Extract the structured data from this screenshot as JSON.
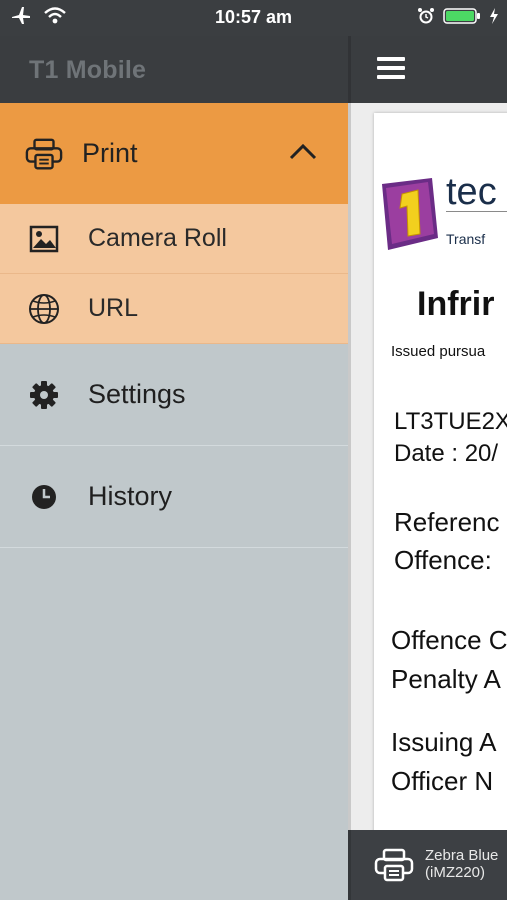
{
  "status_bar": {
    "time": "10:57 am",
    "left_icons": [
      "airplane-icon",
      "wifi-icon"
    ],
    "right_icons": [
      "alarm-icon",
      "battery-icon",
      "charging-icon"
    ]
  },
  "app": {
    "title": "T1 Mobile"
  },
  "drawer": {
    "print": {
      "label": "Print",
      "icon": "printer-icon",
      "expanded": true
    },
    "print_subitems": [
      {
        "label": "Camera Roll",
        "icon": "image-icon"
      },
      {
        "label": "URL",
        "icon": "globe-icon"
      }
    ],
    "items": [
      {
        "label": "Settings",
        "icon": "gear-icon"
      },
      {
        "label": "History",
        "icon": "clock-icon"
      }
    ]
  },
  "document": {
    "logo_text": "tec",
    "tagline": "Transf",
    "title": "Infrir",
    "issued": "Issued pursua",
    "lines": [
      "LT3TUE2X",
      "Date : 20/",
      "Referenc",
      "Offence:",
      "Offence C",
      "Penalty A",
      "Issuing A",
      "Officer N"
    ]
  },
  "printer": {
    "name": "Zebra Blue",
    "model": "(iMZ220)"
  },
  "colors": {
    "accent": "#ec9a43",
    "submenu": "#f4c89e",
    "drawer_bg": "#c0c8cb",
    "header_bg": "#3a3d40"
  }
}
